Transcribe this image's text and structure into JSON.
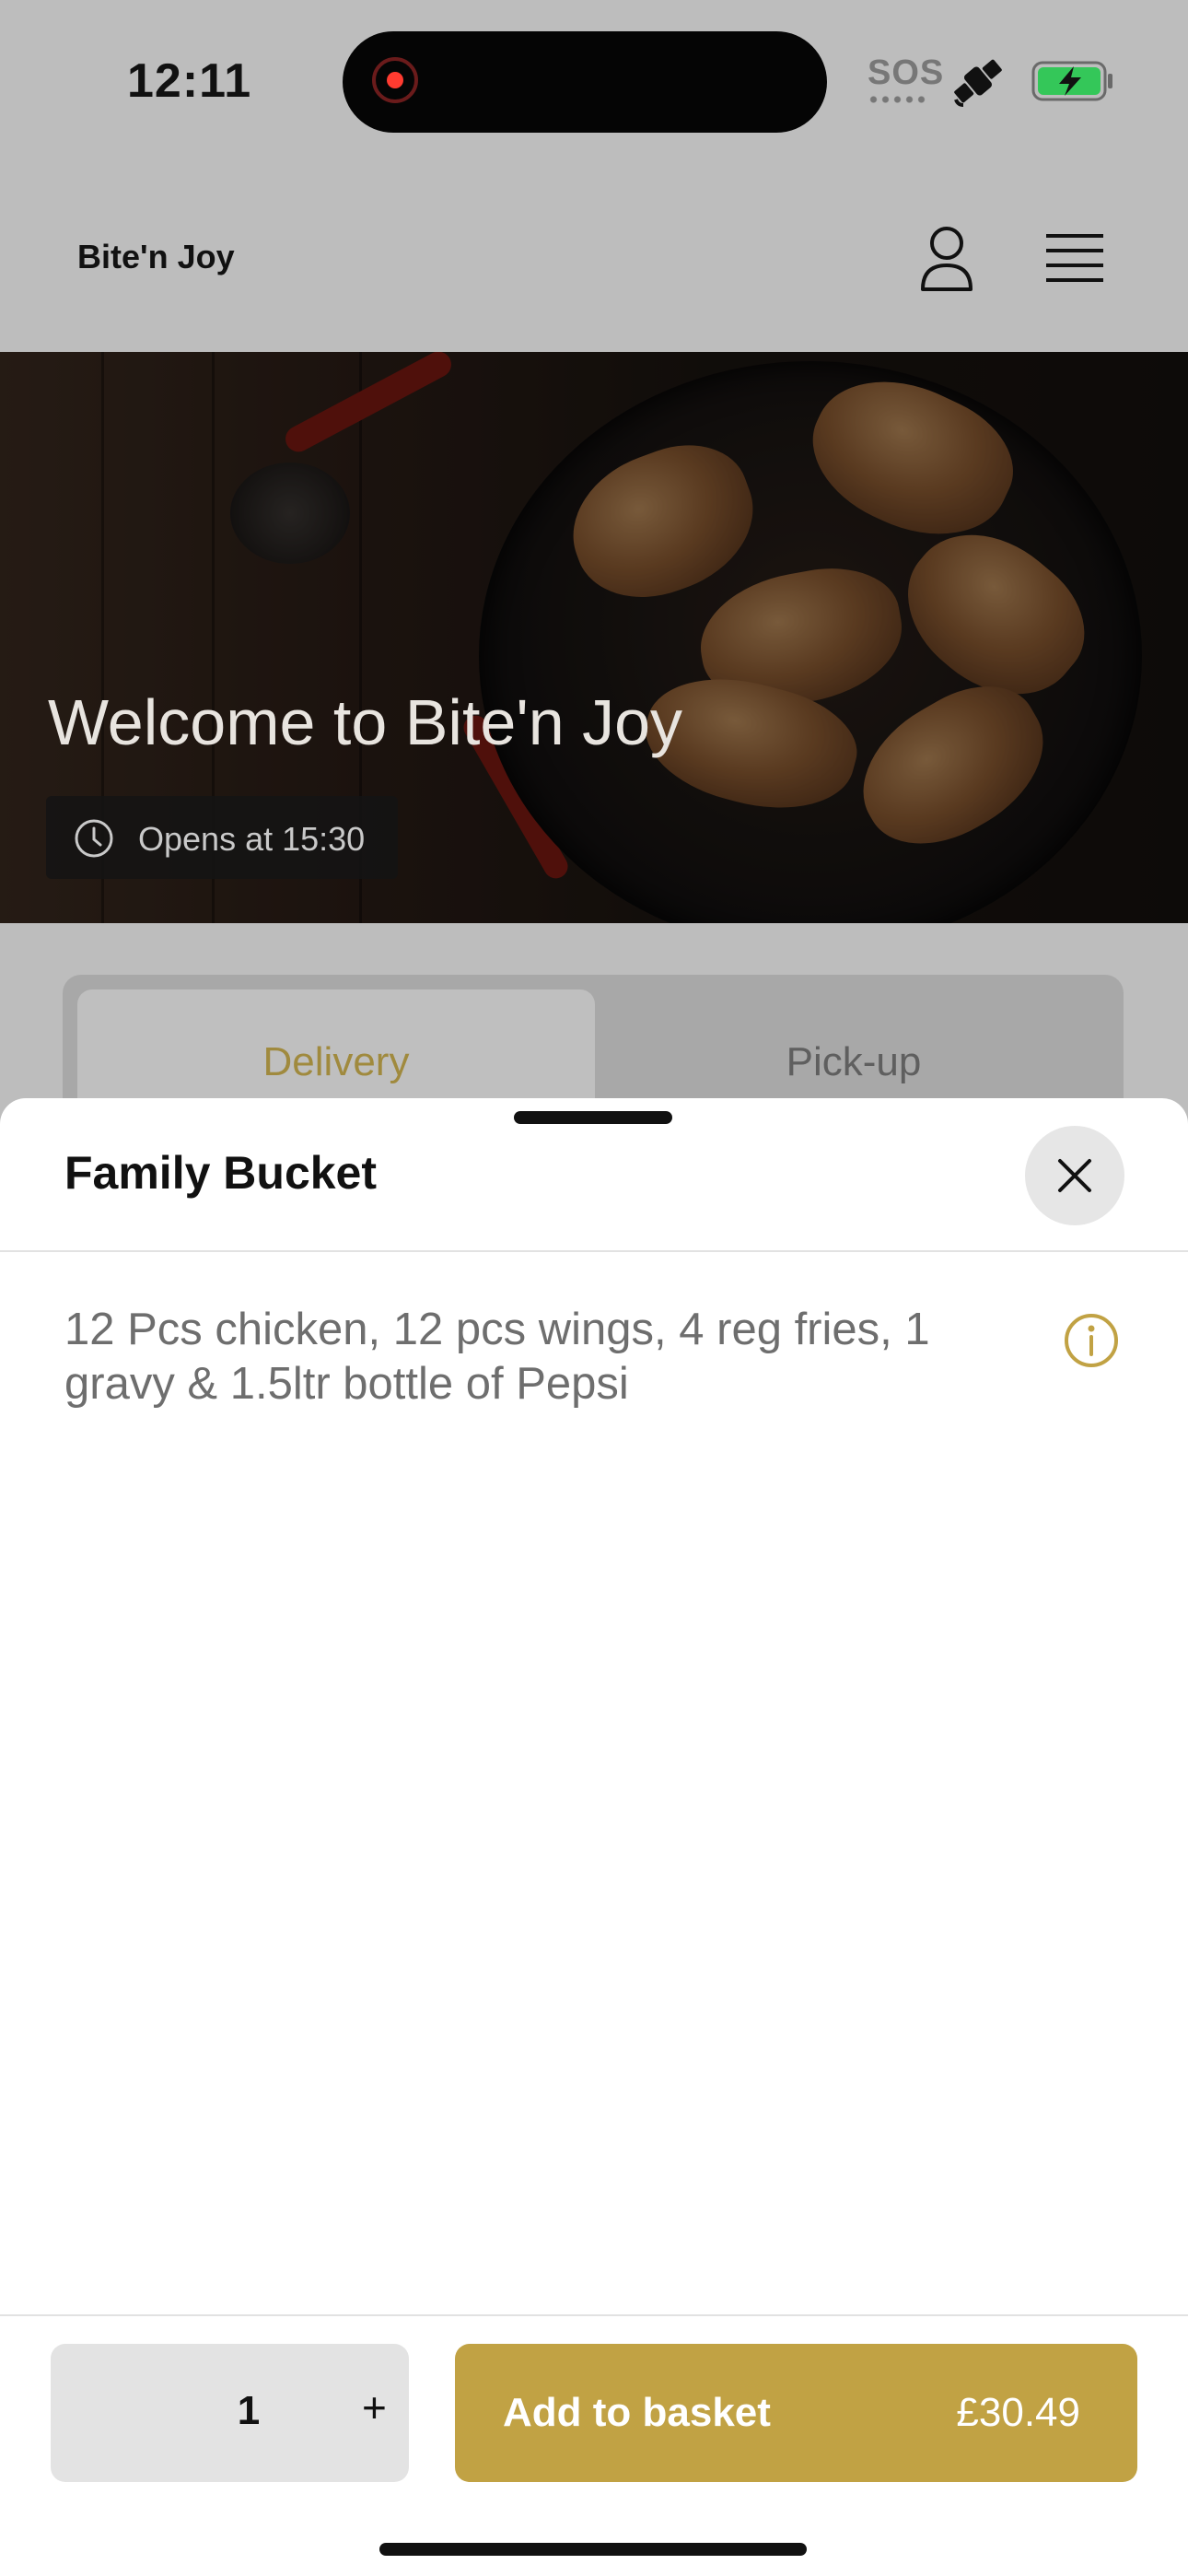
{
  "status_bar": {
    "time": "12:11",
    "sos": "SOS",
    "icons": [
      "record-indicator-icon",
      "satellite-icon",
      "battery-charging-icon"
    ]
  },
  "header": {
    "brand": "Bite'n Joy",
    "icons": [
      "user-icon",
      "menu-icon"
    ]
  },
  "hero": {
    "title": "Welcome to Bite'n Joy",
    "opens": "Opens at 15:30"
  },
  "tabs": [
    {
      "label": "Delivery",
      "selected": true
    },
    {
      "label": "Pick-up",
      "selected": false
    }
  ],
  "sheet": {
    "title": "Family Bucket",
    "description": "12  Pcs chicken, 12 pcs wings, 4 reg fries, 1 gravy & 1.5ltr bottle of Pepsi",
    "quantity": "1",
    "plus": "+",
    "add_label": "Add to basket",
    "price": "£30.49"
  },
  "colors": {
    "accent": "#c1a244",
    "accent_text": "#a08a3e",
    "overlay": "#bdbdbd"
  }
}
